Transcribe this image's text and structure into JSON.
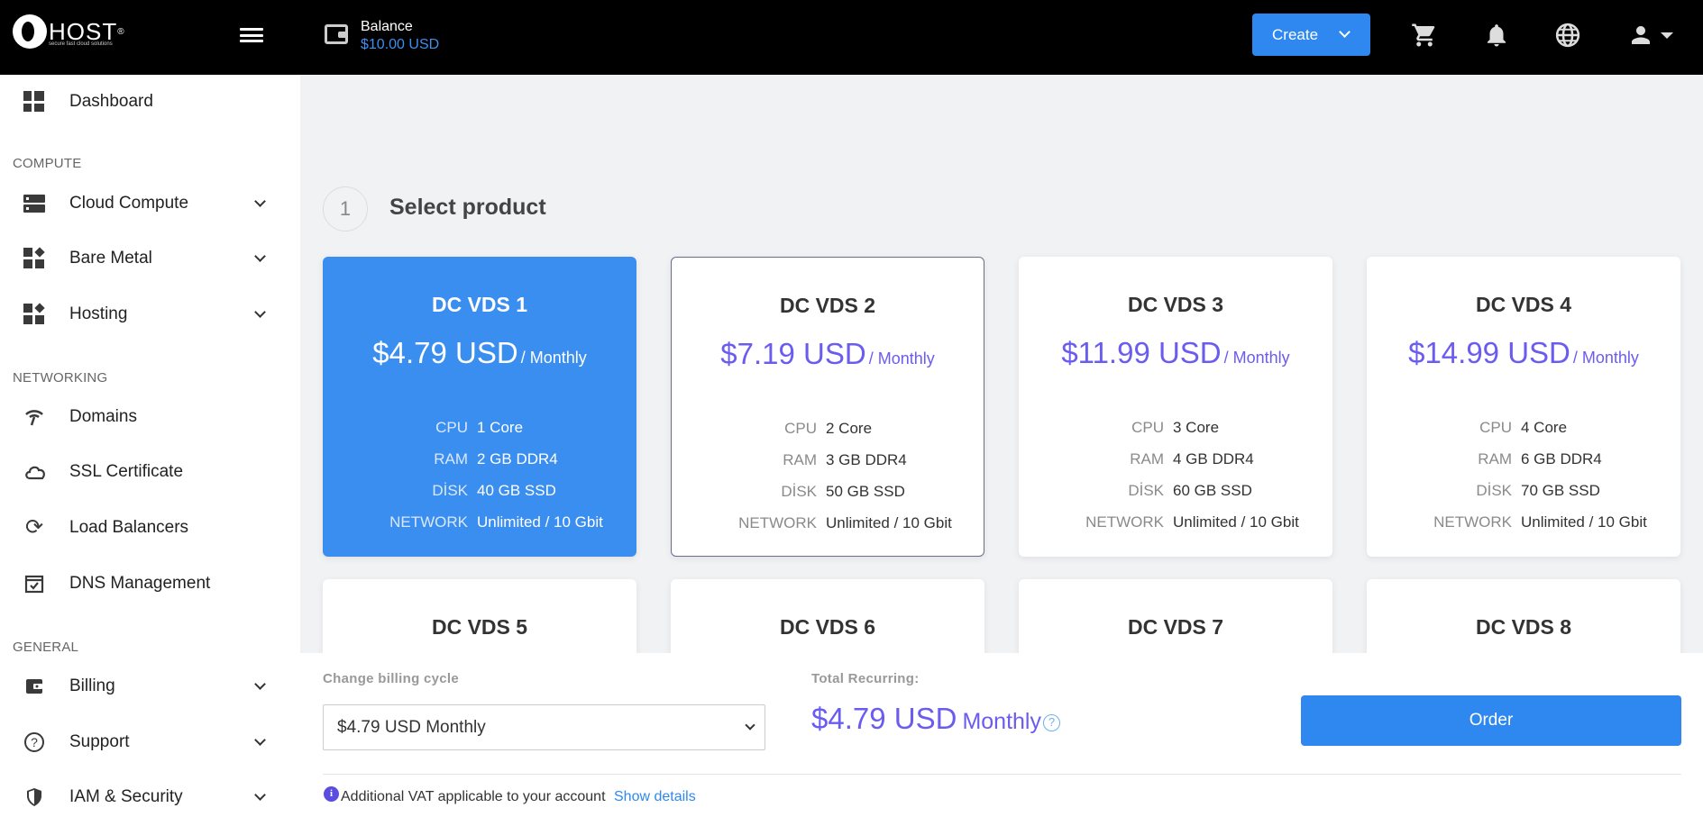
{
  "header": {
    "logo_text": "HOST",
    "logo_tagline": "secure fast cloud solutions",
    "balance_label": "Balance",
    "balance_value": "$10.00 USD",
    "create_label": "Create",
    "icons": [
      "menu-icon",
      "wallet-icon",
      "cart-icon",
      "bell-icon",
      "globe-icon",
      "user-icon"
    ]
  },
  "sidebar": {
    "dashboard": "Dashboard",
    "sections": {
      "compute": "COMPUTE",
      "networking": "NETWORKING",
      "general": "GENERAL"
    },
    "compute_items": [
      {
        "label": "Cloud Compute"
      },
      {
        "label": "Bare Metal"
      },
      {
        "label": "Hosting"
      }
    ],
    "networking_items": [
      {
        "label": "Domains"
      },
      {
        "label": "SSL Certificate"
      },
      {
        "label": "Load Balancers"
      },
      {
        "label": "DNS Management"
      }
    ],
    "general_items": [
      {
        "label": "Billing"
      },
      {
        "label": "Support"
      },
      {
        "label": "IAM & Security"
      }
    ]
  },
  "step": {
    "number": "1",
    "title": "Select product"
  },
  "spec_labels": {
    "cpu": "CPU",
    "ram": "RAM",
    "disk": "DİSK",
    "network": "NETWORK"
  },
  "products": [
    {
      "name": "DC VDS 1",
      "price": "$4.79 USD",
      "period": "/ Monthly",
      "cpu": "1 Core",
      "ram": "2 GB DDR4",
      "disk": "40 GB SSD",
      "network": "Unlimited / 10 Gbit"
    },
    {
      "name": "DC VDS 2",
      "price": "$7.19 USD",
      "period": "/ Monthly",
      "cpu": "2 Core",
      "ram": "3 GB DDR4",
      "disk": "50 GB SSD",
      "network": "Unlimited / 10 Gbit"
    },
    {
      "name": "DC VDS 3",
      "price": "$11.99 USD",
      "period": "/ Monthly",
      "cpu": "3 Core",
      "ram": "4 GB DDR4",
      "disk": "60 GB SSD",
      "network": "Unlimited / 10 Gbit"
    },
    {
      "name": "DC VDS 4",
      "price": "$14.99 USD",
      "period": "/ Monthly",
      "cpu": "4 Core",
      "ram": "6 GB DDR4",
      "disk": "70 GB SSD",
      "network": "Unlimited / 10 Gbit"
    },
    {
      "name": "DC VDS 5"
    },
    {
      "name": "DC VDS 6"
    },
    {
      "name": "DC VDS 7"
    },
    {
      "name": "DC VDS 8"
    }
  ],
  "billing": {
    "cycle_label": "Change billing cycle",
    "cycle_selected": "$4.79 USD Monthly",
    "total_label": "Total Recurring:",
    "total_amount": "$4.79 USD",
    "total_period": "Monthly",
    "order_label": "Order",
    "vat_text": "Additional VAT applicable to your account",
    "show_details": "Show details"
  },
  "colors": {
    "accent": "#2f88ef",
    "selected_card": "#3a8ef0",
    "price": "#6b5cf0",
    "topbar": "#000000"
  }
}
